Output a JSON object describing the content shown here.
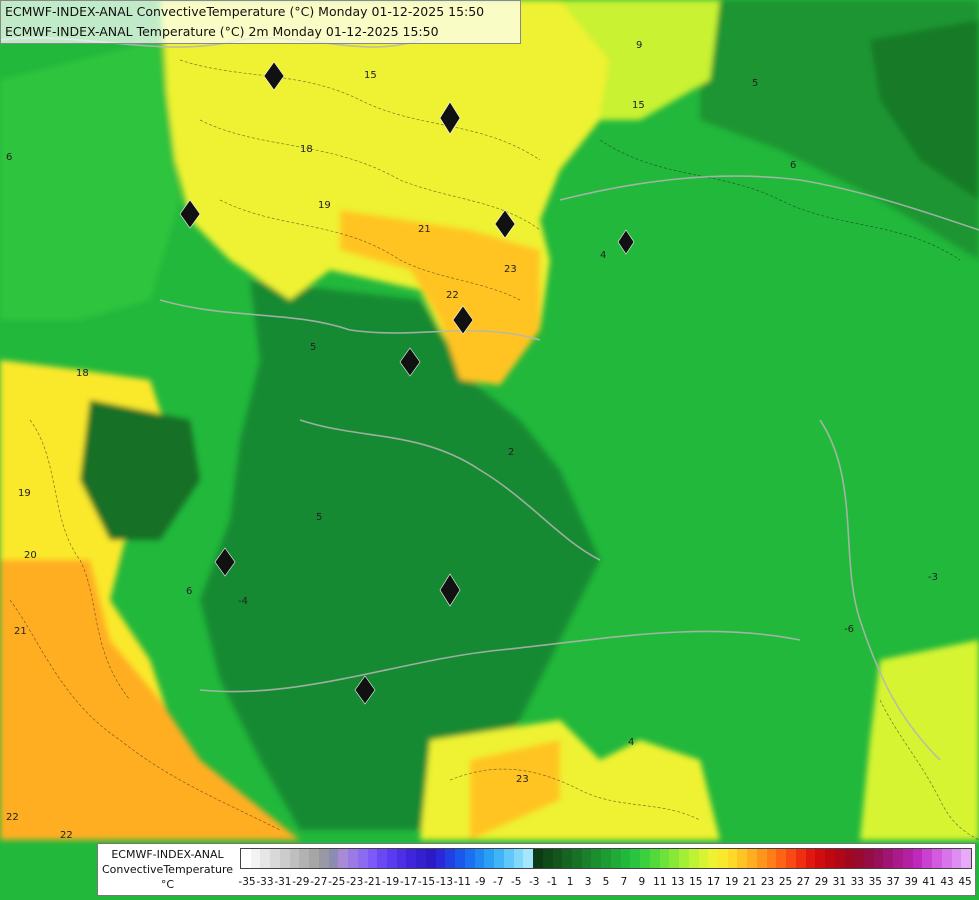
{
  "header": {
    "line1": "ECMWF-INDEX-ANAL ConvectiveTemperature (°C) Monday 01-12-2025 15:50",
    "line2": "ECMWF-INDEX-ANAL Temperature (°C) 2m Monday 01-12-2025 15:50"
  },
  "legend": {
    "title_line1": "ECMWF-INDEX-ANAL",
    "title_line2": "ConvectiveTemperature",
    "unit": "°C",
    "tick_labels": [
      "-35",
      "-33",
      "-31",
      "-29",
      "-27",
      "-25",
      "-23",
      "-21",
      "-19",
      "-17",
      "-15",
      "-13",
      "-11",
      "-9",
      "-7",
      "-5",
      "-3",
      "-1",
      "1",
      "3",
      "5",
      "7",
      "9",
      "11",
      "13",
      "15",
      "17",
      "19",
      "21",
      "23",
      "25",
      "27",
      "29",
      "31",
      "33",
      "35",
      "37",
      "39",
      "41",
      "43",
      "45"
    ],
    "colors": [
      "#ffffff",
      "#f3f3f3",
      "#e6e6e6",
      "#d9d9d9",
      "#cccccc",
      "#bfbfbf",
      "#b2b2b2",
      "#a6a6a6",
      "#9999a6",
      "#8c8cb2",
      "#a98ad6",
      "#9b7ae6",
      "#8c6af2",
      "#7d5af8",
      "#6a48f2",
      "#5a3cf0",
      "#4d30e6",
      "#3f26dc",
      "#3520d0",
      "#2c1ac4",
      "#2a28d8",
      "#2040e4",
      "#1a58ec",
      "#1a70f0",
      "#2088f2",
      "#2aa0f4",
      "#40b4f6",
      "#60c8f8",
      "#80d8fa",
      "#a6e6fc",
      "#0c3c14",
      "#0f4a18",
      "#12561c",
      "#156421",
      "#177226",
      "#19802b",
      "#1b8e30",
      "#1d9c34",
      "#20aa38",
      "#22b83c",
      "#2ac43e",
      "#3ad03e",
      "#52da3c",
      "#6ce23a",
      "#88e838",
      "#a4ee36",
      "#bef234",
      "#d6f432",
      "#eef230",
      "#fae82c",
      "#ffd828",
      "#ffc424",
      "#ffae20",
      "#ff961c",
      "#ff7e18",
      "#ff6414",
      "#f84a12",
      "#ee3010",
      "#e0180e",
      "#d00c0c",
      "#c00810",
      "#b00818",
      "#a00820",
      "#980a30",
      "#960c44",
      "#98105a",
      "#a01472",
      "#aa1a8a",
      "#b420a2",
      "#c028bc",
      "#ca40d0",
      "#d25ade",
      "#d874ea",
      "#de8ef2",
      "#e6aaf8"
    ]
  },
  "map": {
    "contour_labels": [
      "15",
      "18",
      "19",
      "21",
      "22",
      "23",
      "9",
      "15",
      "5",
      "6",
      "4",
      "5",
      "2",
      "6",
      "-4",
      "5",
      "4",
      "-6",
      "20",
      "21",
      "23",
      "22",
      "22",
      "19",
      "18",
      "6",
      "-3"
    ]
  }
}
